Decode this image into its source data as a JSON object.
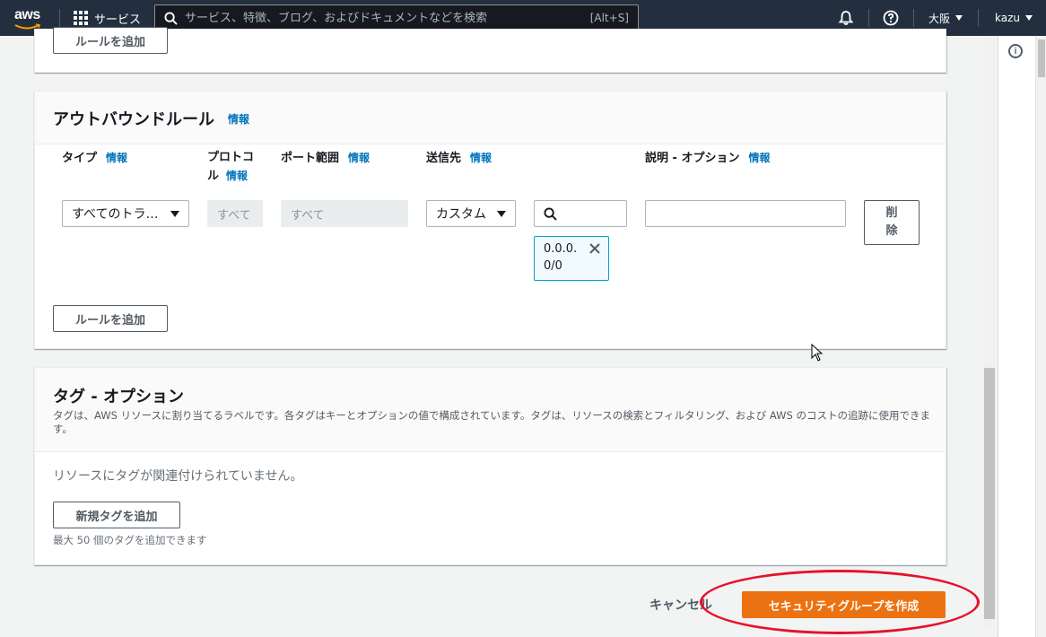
{
  "nav": {
    "logo": "aws",
    "services": "サービス",
    "search_placeholder": "サービス、特徴、ブログ、およびドキュメントなどを検索",
    "search_shortcut": "[Alt+S]",
    "region": "大阪",
    "user": "kazu"
  },
  "inbound_tail": {
    "add_rule": "ルールを追加"
  },
  "outbound": {
    "title": "アウトバウンドルール",
    "info": "情報",
    "columns": {
      "type": "タイプ",
      "protocol": "プロトコル",
      "port": "ポート範囲",
      "dest": "送信先",
      "desc": "説明 - オプション"
    },
    "row": {
      "type_value": "すべてのトラ…",
      "protocol_value": "すべて",
      "port_value": "すべて",
      "dest_value": "カスタム",
      "cidr_token": "0.0.0.0/0",
      "delete": "削除"
    },
    "add_rule": "ルールを追加"
  },
  "tags": {
    "title": "タグ - オプション",
    "description": "タグは、AWS リソースに割り当てるラベルです。各タグはキーとオプションの値で構成されています。タグは、リソースの検索とフィルタリング、および AWS のコストの追跡に使用できます。",
    "empty": "リソースにタグが関連付けられていません。",
    "add_tag": "新規タグを追加",
    "limit_note": "最大 50 個のタグを追加できます"
  },
  "footer": {
    "cancel": "キャンセル",
    "create": "セキュリティグループを作成"
  },
  "colors": {
    "nav_bg": "#232f3e",
    "primary": "#ec7211",
    "link": "#0073bb",
    "annotation": "#e8102a"
  }
}
